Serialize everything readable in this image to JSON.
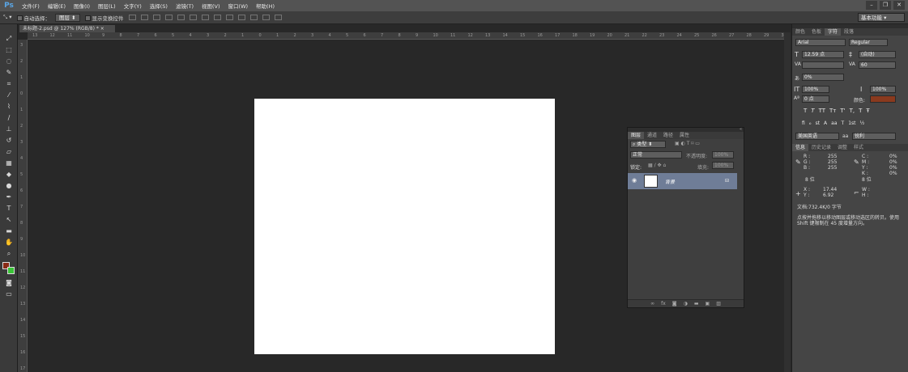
{
  "menu": {
    "logo": "Ps",
    "items": [
      "文件(F)",
      "编辑(E)",
      "图像(I)",
      "图层(L)",
      "文字(Y)",
      "选择(S)",
      "滤镜(T)",
      "视图(V)",
      "窗口(W)",
      "帮助(H)"
    ]
  },
  "options": {
    "auto_select_label": "自动选择：",
    "auto_select_value": "图层",
    "show_transform_label": "显示变换控件",
    "workspace": "基本功能"
  },
  "document": {
    "tab_title": "未标题-2.psd @ 127% (RGB/8) *",
    "ruler_h": [
      "13",
      "12",
      "11",
      "10",
      "9",
      "8",
      "7",
      "6",
      "5",
      "4",
      "3",
      "2",
      "1",
      "0",
      "1",
      "2",
      "3",
      "4",
      "5",
      "6",
      "7",
      "8",
      "9",
      "10",
      "11",
      "12",
      "13",
      "14",
      "15",
      "16",
      "17",
      "18",
      "19",
      "20",
      "21",
      "22",
      "23",
      "24",
      "25",
      "26",
      "27",
      "28",
      "29",
      "30"
    ],
    "ruler_v": [
      "3",
      "2",
      "1",
      "0",
      "1",
      "2",
      "3",
      "4",
      "5",
      "6",
      "7",
      "8",
      "9",
      "10",
      "11",
      "12",
      "13",
      "14",
      "15",
      "16",
      "17"
    ]
  },
  "character_panel": {
    "tabs": [
      "颜色",
      "色板",
      "字符",
      "段落"
    ],
    "font_family": "Arial",
    "font_style": "Regular",
    "font_size": "12.59 点",
    "leading": "(自动)",
    "tracking": "60",
    "scale_pct": "0%",
    "vscale": "100%",
    "hscale": "100%",
    "baseline": "0 点",
    "color_label": "颜色:",
    "language": "美国英语",
    "aa_label": "aa",
    "antialias": "锐利",
    "text_color": "#8a3a1e"
  },
  "info_panel": {
    "tabs": [
      "信息",
      "历史记录",
      "调整",
      "样式"
    ],
    "r": "255",
    "g": "255",
    "b": "255",
    "c": "0%",
    "m": "0%",
    "y": "0%",
    "k": "0%",
    "bits_left": "8 位",
    "bits_right": "8 位",
    "x": "17.44",
    "y_coord": "6.92",
    "doc_size": "文档:732.4K/0 字节",
    "hint": "点按并拖移以移动图层或移动选区的转贝。使用 Shift 键限制在 45 度增量方向。"
  },
  "layers_panel": {
    "tabs": [
      "图层",
      "通道",
      "路径",
      "属性"
    ],
    "filter": "类型",
    "blend_mode": "正常",
    "opacity_label": "不透明度:",
    "opacity": "100%",
    "lock_label": "锁定:",
    "fill_label": "填充:",
    "fill": "100%",
    "layer_name": "背景",
    "footer_link": "∞",
    "footer_fx": "fx"
  }
}
